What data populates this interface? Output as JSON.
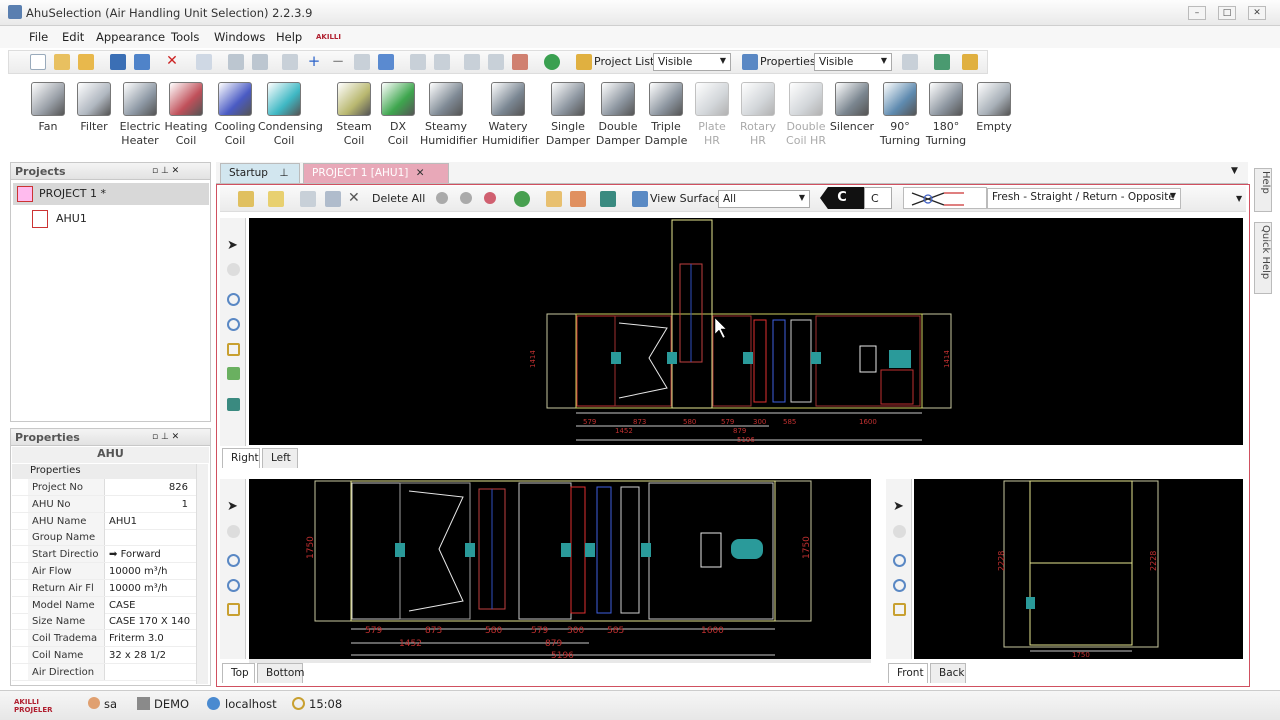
{
  "window": {
    "title": "AhuSelection (Air Handling Unit Selection) 2.2.3.9"
  },
  "menu": [
    "File",
    "Edit",
    "Appearance",
    "Tools",
    "Windows",
    "Help"
  ],
  "brand": "AKILLI PROJELER",
  "toolbar": {
    "project_list_label": "Project List",
    "project_list_value": "Visible",
    "properties_label": "Properties",
    "properties_value": "Visible"
  },
  "palette": [
    {
      "label": "Fan",
      "color": "#9aa0a8",
      "disabled": false
    },
    {
      "label": "Filter",
      "color": "#b0b7c0",
      "disabled": false
    },
    {
      "label": "Electric\nHeater",
      "color": "#8f9aa6",
      "disabled": false
    },
    {
      "label": "Heating\nCoil",
      "color": "#c0505a",
      "disabled": false
    },
    {
      "label": "Cooling\nCoil",
      "color": "#4a5bc4",
      "disabled": false
    },
    {
      "label": "Condensing\nCoil",
      "color": "#3fb8c4",
      "disabled": false
    },
    {
      "label": "Steam\nCoil",
      "color": "#b9b870",
      "disabled": false
    },
    {
      "label": "DX\nCoil",
      "color": "#3ea64e",
      "disabled": false
    },
    {
      "label": "Steamy\nHumidifier",
      "color": "#7f8a95",
      "disabled": false
    },
    {
      "label": "Watery\nHumidifier",
      "color": "#7b8793",
      "disabled": false
    },
    {
      "label": "Single\nDamper",
      "color": "#8d96a0",
      "disabled": false
    },
    {
      "label": "Double\nDamper",
      "color": "#8d96a0",
      "disabled": false
    },
    {
      "label": "Triple\nDample",
      "color": "#8d96a0",
      "disabled": false
    },
    {
      "label": "Plate\nHR",
      "color": "#9ea6ae",
      "disabled": true
    },
    {
      "label": "Rotary\nHR",
      "color": "#9ea6ae",
      "disabled": true
    },
    {
      "label": "Double\nCoil HR",
      "color": "#9ea6ae",
      "disabled": true
    },
    {
      "label": "Silencer",
      "color": "#7b8690",
      "disabled": false
    },
    {
      "label": "90°\nTurning",
      "color": "#5f8bb0",
      "disabled": false
    },
    {
      "label": "180°\nTurning",
      "color": "#8d96a0",
      "disabled": false
    },
    {
      "label": "Empty",
      "color": "#a8b0b8",
      "disabled": false
    }
  ],
  "projects": {
    "title": "Projects",
    "root": "PROJECT 1 *",
    "child": "AHU1"
  },
  "properties": {
    "title": "Properties",
    "object": "AHU",
    "group": "Properties",
    "rows": [
      {
        "label": "Project No",
        "value": "826"
      },
      {
        "label": "AHU No",
        "value": "1"
      },
      {
        "label": "AHU Name",
        "value": "AHU1"
      },
      {
        "label": "Group Name",
        "value": ""
      },
      {
        "label": "Start Directio",
        "value": "Forward"
      },
      {
        "label": "Air Flow",
        "value": "10000  m³/h"
      },
      {
        "label": "Return Air Fl",
        "value": "10000  m³/h"
      },
      {
        "label": "Model Name",
        "value": "CASE"
      },
      {
        "label": "Size Name",
        "value": "CASE 170 X 140"
      },
      {
        "label": "Coil Tradema",
        "value": "Friterm 3.0"
      },
      {
        "label": "Coil Name",
        "value": "32 x 28 1/2"
      },
      {
        "label": "Air Direction",
        "value": ""
      }
    ]
  },
  "doc_tabs": [
    "Startup",
    "PROJECT 1 [AHU1]"
  ],
  "doc_toolbar": {
    "delete_all": "Delete All",
    "view_surface_label": "View Surface",
    "view_surface_value": "All",
    "c_label": "C",
    "c_value": "C",
    "flow_value": "Fresh - Straight / Return - Opposite"
  },
  "view_tabs": {
    "top_view": [
      "Right",
      "Left"
    ],
    "bottom_left": [
      "Top",
      "Bottom"
    ],
    "bottom_right": [
      "Front",
      "Back"
    ]
  },
  "dims": {
    "side": [
      "579",
      "873",
      "580",
      "579",
      "300",
      "585",
      "1600",
      "1452",
      "879",
      "5196",
      "1414",
      "1414"
    ],
    "top": [
      "579",
      "873",
      "580",
      "579",
      "300",
      "585",
      "1600",
      "1452",
      "879",
      "5196",
      "1750",
      "1750"
    ],
    "front": [
      "2228",
      "2228",
      "1750"
    ]
  },
  "status": {
    "user": "sa",
    "db": "DEMO",
    "server": "localhost",
    "time": "15:08"
  },
  "side_tabs": [
    "Help",
    "Quick Help"
  ]
}
